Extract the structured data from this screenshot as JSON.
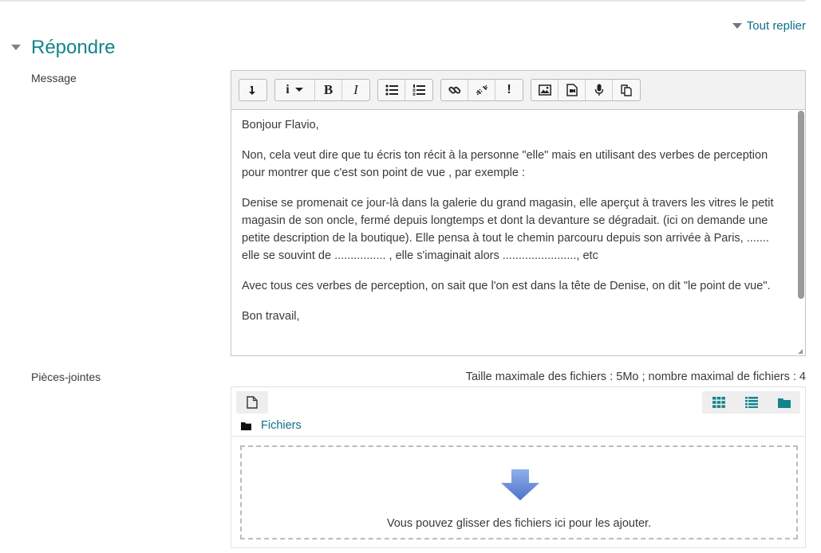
{
  "header": {
    "reply_all_label": "Tout replier",
    "section_title": "Répondre"
  },
  "form": {
    "message_label": "Message",
    "attachments_label": "Pièces-jointes"
  },
  "editor": {
    "paragraphs": [
      "Bonjour Flavio,",
      "Non, cela veut dire que tu écris ton récit à la personne \"elle\" mais en utilisant des verbes de perception pour montrer que c'est son point de vue , par exemple :",
      "Denise se promenait ce jour-là dans la galerie du grand magasin, elle aperçut à travers les vitres le petit magasin de son oncle, fermé depuis longtemps et dont la devanture se  dégradait. (ici on demande une petite description de la boutique). Elle pensa à tout le chemin parcouru depuis son arrivée à Paris, ....... elle se souvint de ................ , elle s'imaginait alors ......................., etc",
      "Avec tous ces verbes de perception, on sait que l'on est dans la tête de Denise, on dit \"le point de vue\".",
      "Bon travail,"
    ],
    "toolbar": {
      "bold_label": "B",
      "italic_label": "I",
      "info_label": "i",
      "unlink_label": "!"
    }
  },
  "files": {
    "limits_text": "Taille maximale des fichiers : 5Mo ; nombre maximal de fichiers : 4",
    "path_label": "Fichiers",
    "drop_text": "Vous pouvez glisser des fichiers ici pour les ajouter."
  },
  "colors": {
    "accent": "#14848c",
    "link": "#0f6f8a",
    "arrow": "#6b8fd6"
  }
}
